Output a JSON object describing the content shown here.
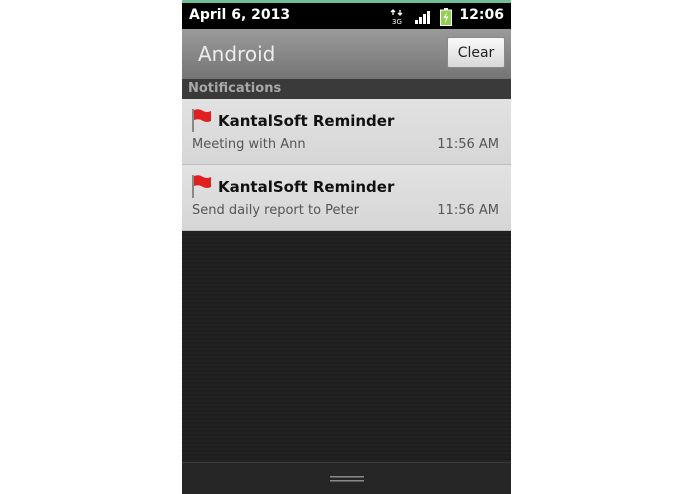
{
  "status_bar": {
    "date": "April 6, 2013",
    "time": "12:06",
    "network_label": "3G",
    "icons": [
      "network-3g-icon",
      "signal-icon",
      "battery-charging-icon"
    ]
  },
  "header": {
    "title": "Android",
    "clear_label": "Clear"
  },
  "section": {
    "label": "Notifications"
  },
  "notifications": [
    {
      "icon": "red-flag-icon",
      "title": "KantalSoft Reminder",
      "text": "Meeting with Ann",
      "time": "11:56 AM"
    },
    {
      "icon": "red-flag-icon",
      "title": "KantalSoft Reminder",
      "text": "Send daily report to Peter",
      "time": "11:56 AM"
    }
  ],
  "colors": {
    "accent_line": "#6fbf9a",
    "flag": "#e02020",
    "battery": "#8fd14f"
  }
}
